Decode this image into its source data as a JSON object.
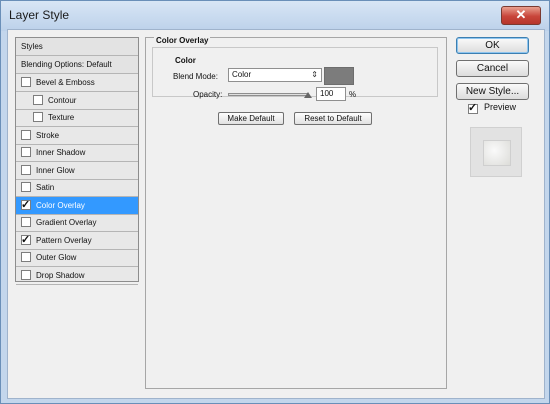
{
  "window": {
    "title": "Layer Style",
    "close_glyph": "✕"
  },
  "styles_list": {
    "header": "Styles",
    "blending_options": "Blending Options: Default",
    "items": [
      {
        "label": "Bevel & Emboss",
        "checked": false,
        "indent": 0,
        "selected": false
      },
      {
        "label": "Contour",
        "checked": false,
        "indent": 1,
        "selected": false
      },
      {
        "label": "Texture",
        "checked": false,
        "indent": 1,
        "selected": false
      },
      {
        "label": "Stroke",
        "checked": false,
        "indent": 0,
        "selected": false
      },
      {
        "label": "Inner Shadow",
        "checked": false,
        "indent": 0,
        "selected": false
      },
      {
        "label": "Inner Glow",
        "checked": false,
        "indent": 0,
        "selected": false
      },
      {
        "label": "Satin",
        "checked": false,
        "indent": 0,
        "selected": false
      },
      {
        "label": "Color Overlay",
        "checked": true,
        "indent": 0,
        "selected": true
      },
      {
        "label": "Gradient Overlay",
        "checked": false,
        "indent": 0,
        "selected": false
      },
      {
        "label": "Pattern Overlay",
        "checked": true,
        "indent": 0,
        "selected": false
      },
      {
        "label": "Outer Glow",
        "checked": false,
        "indent": 0,
        "selected": false
      },
      {
        "label": "Drop Shadow",
        "checked": false,
        "indent": 0,
        "selected": false
      }
    ]
  },
  "color_overlay": {
    "section_title": "Color Overlay",
    "group_title": "Color",
    "blend_mode_label": "Blend Mode:",
    "blend_mode_value": "Color",
    "overlay_color": "#7c7c7c",
    "opacity_label": "Opacity:",
    "opacity_value": "100",
    "opacity_unit": "%",
    "make_default": "Make Default",
    "reset_default": "Reset to Default"
  },
  "actions": {
    "ok": "OK",
    "cancel": "Cancel",
    "new_style": "New Style...",
    "preview_label": "Preview",
    "preview_checked": true
  }
}
